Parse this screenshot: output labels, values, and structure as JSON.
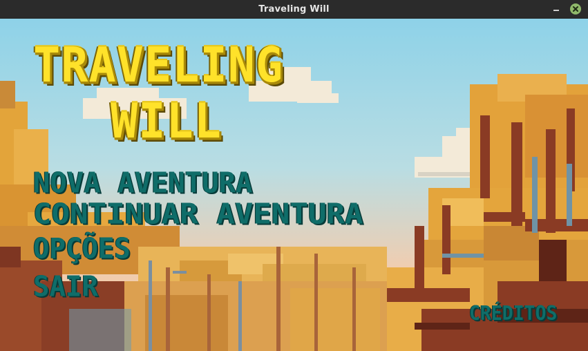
{
  "window": {
    "title": "Traveling Will"
  },
  "logo": {
    "line1": "TRAVELING",
    "line2": "WILL"
  },
  "menu": {
    "new_adventure": "NOVA AVENTURA",
    "continue_adventure": "CONTINUAR AVENTURA",
    "options": "OPÇÕES",
    "quit": "SAIR"
  },
  "credits_label": "CRÉDITOS",
  "colors": {
    "sky_top": "#8fd0e6",
    "sky_bottom": "#f3c8a8",
    "logo_yellow": "#ffe22a",
    "menu_teal": "#0f6d69",
    "foliage_gold": "#e8a32e",
    "trunk_brown": "#8a3b24"
  }
}
